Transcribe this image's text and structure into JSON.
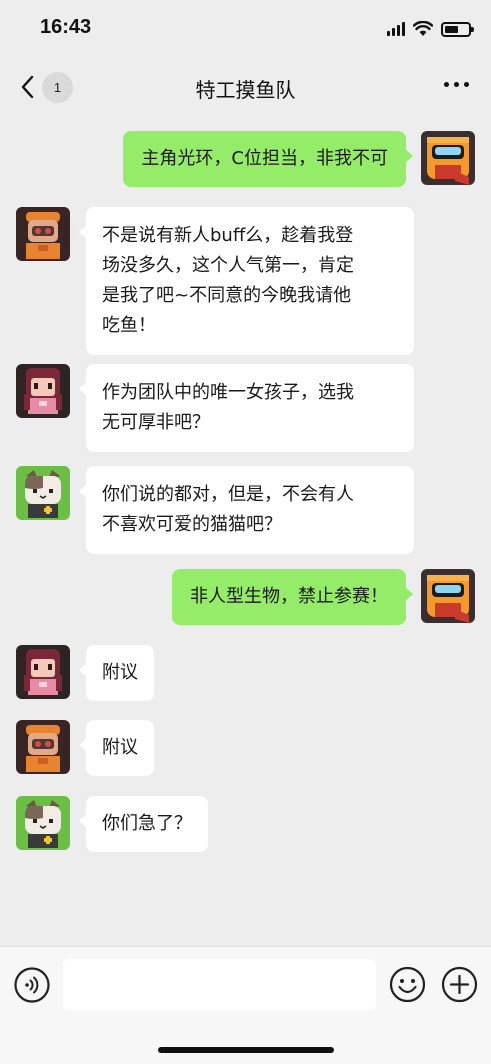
{
  "status_bar": {
    "time": "16:43"
  },
  "header": {
    "title": "特工摸鱼队",
    "unread_count": "1"
  },
  "messages": [
    {
      "side": "right",
      "sender": "orange",
      "text": "主角光环，C位担当，非我不可"
    },
    {
      "side": "left",
      "sender": "robot",
      "lines": [
        "不是说有新人buff么，趁着我登",
        "场没多久，这个人气第一，肯定",
        "是我了吧~不同意的今晚我请他",
        "吃鱼！"
      ]
    },
    {
      "side": "left",
      "sender": "girl",
      "lines": [
        "作为团队中的唯一女孩子，选我",
        "无可厚非吧？"
      ]
    },
    {
      "side": "left",
      "sender": "cat",
      "lines": [
        "你们说的都对，但是，不会有人",
        "不喜欢可爱的猫猫吧？"
      ]
    },
    {
      "side": "right",
      "sender": "orange",
      "text": "非人型生物，禁止参赛！"
    },
    {
      "side": "left",
      "sender": "girl",
      "text": "附议"
    },
    {
      "side": "left",
      "sender": "robot",
      "text": "附议"
    },
    {
      "side": "left",
      "sender": "cat",
      "text": "你们急了？"
    }
  ],
  "input": {
    "placeholder": ""
  },
  "icons": {
    "back": "chevron-left-icon",
    "more": "more-dots-icon",
    "voice": "voice-icon",
    "emoji": "emoji-icon",
    "plus": "plus-icon"
  },
  "colors": {
    "self_bubble": "#95ec69",
    "other_bubble": "#ffffff",
    "background": "#ededed"
  }
}
